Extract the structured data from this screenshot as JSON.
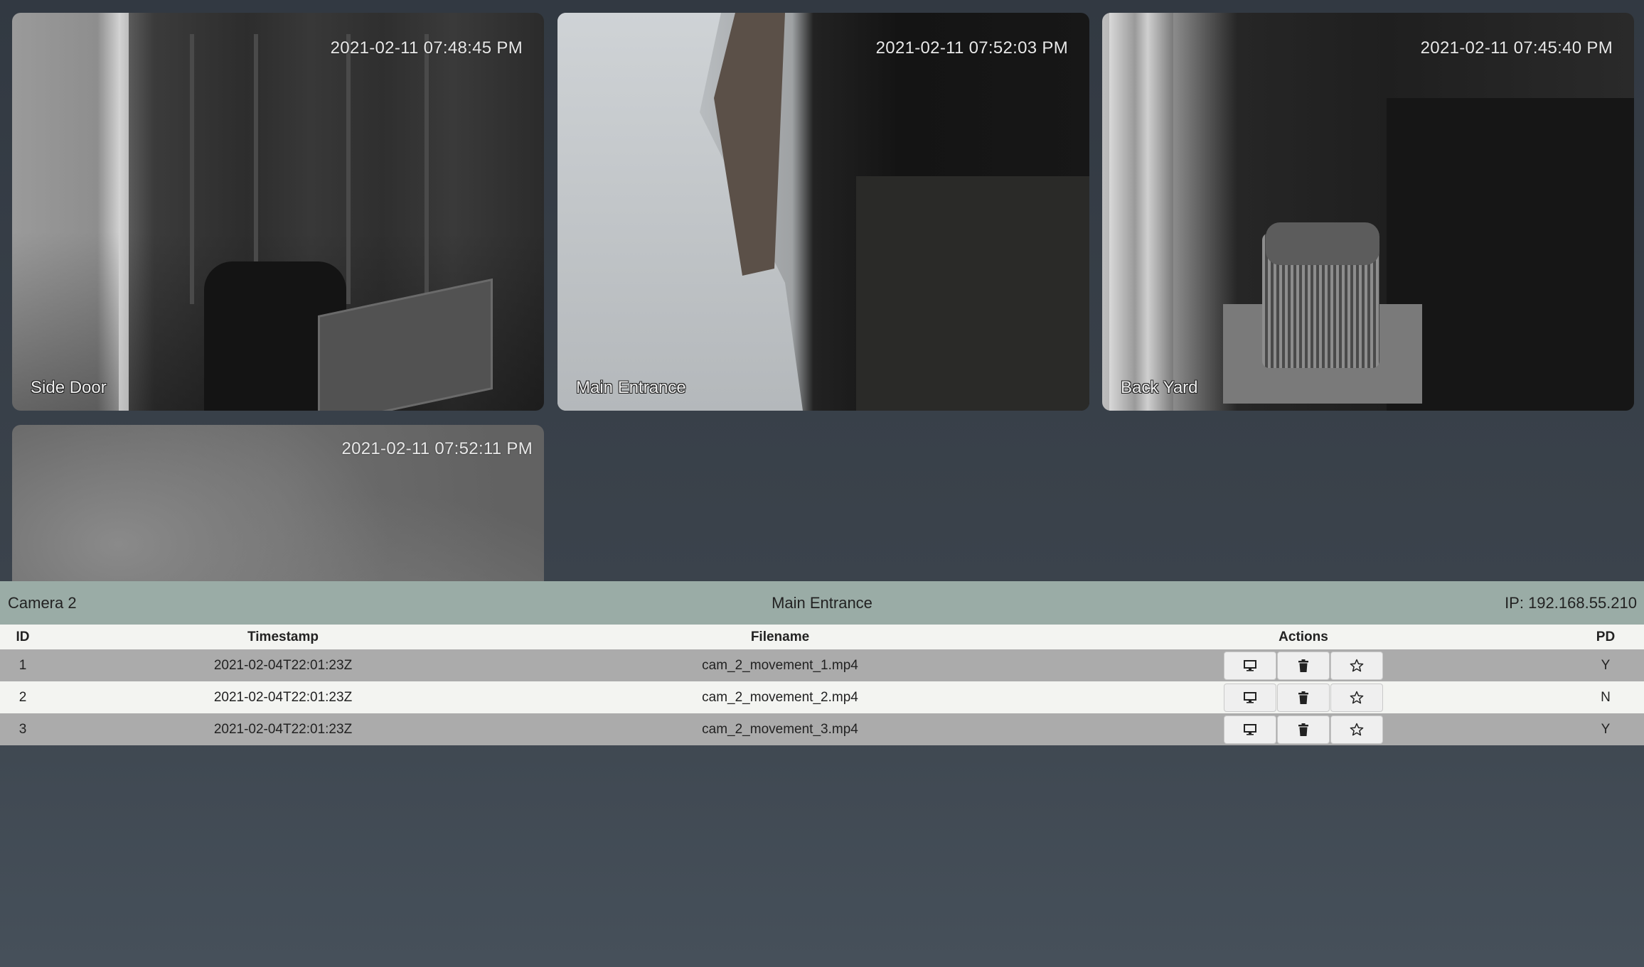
{
  "cameras": [
    {
      "timestamp": "2021-02-11 07:48:45 PM",
      "label": "Side Door"
    },
    {
      "timestamp": "2021-02-11 07:52:03 PM",
      "label": "Main Entrance"
    },
    {
      "timestamp": "2021-02-11 07:45:40 PM",
      "label": "Back Yard"
    },
    {
      "timestamp": "2021-02-11 07:52:11 PM",
      "label": ""
    }
  ],
  "detail": {
    "camera_name": "Camera 2",
    "location": "Main Entrance",
    "ip": "IP: 192.168.55.210"
  },
  "table": {
    "headers": {
      "id": "ID",
      "timestamp": "Timestamp",
      "filename": "Filename",
      "actions": "Actions",
      "pd": "PD"
    },
    "rows": [
      {
        "id": "1",
        "timestamp": "2021-02-04T22:01:23Z",
        "filename": "cam_2_movement_1.mp4",
        "pd": "Y"
      },
      {
        "id": "2",
        "timestamp": "2021-02-04T22:01:23Z",
        "filename": "cam_2_movement_2.mp4",
        "pd": "N"
      },
      {
        "id": "3",
        "timestamp": "2021-02-04T22:01:23Z",
        "filename": "cam_2_movement_3.mp4",
        "pd": "Y"
      }
    ],
    "action_icons": [
      "monitor-icon",
      "trash-icon",
      "star-icon"
    ]
  }
}
